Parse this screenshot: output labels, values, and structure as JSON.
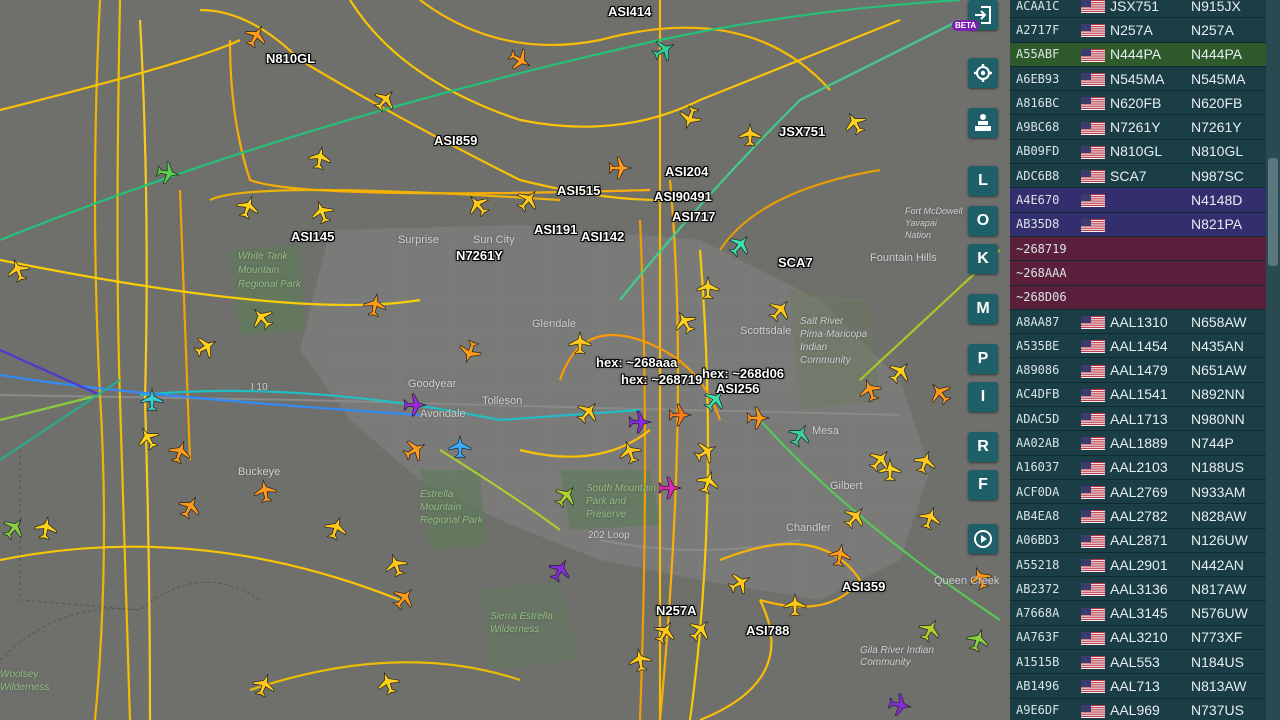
{
  "map": {
    "place_labels": [
      {
        "text": "Surprise"
      },
      {
        "text": "Sun City"
      },
      {
        "text": "Goodyear"
      },
      {
        "text": "Buckeye"
      },
      {
        "text": "Chandler"
      },
      {
        "text": "Gilbert"
      },
      {
        "text": "Fountain Hills"
      },
      {
        "text": "Queen Creek"
      },
      {
        "text": "Glendale"
      },
      {
        "text": "Scottsdale"
      },
      {
        "text": "Mesa"
      },
      {
        "text": "Tolleson"
      },
      {
        "text": "Avondale"
      }
    ],
    "park_labels": [
      {
        "text": "White Tank Mountain Regional Park"
      },
      {
        "text": "Estrella Mountain Regional Park"
      },
      {
        "text": "South Mountain Park and Preserve"
      },
      {
        "text": "Sierra Estrella Wilderness"
      },
      {
        "text": "Woolsey Wilderness"
      },
      {
        "text": "Salt River Pima-Maricopa Indian Community"
      },
      {
        "text": "Fort McDowell Yavapai Nation"
      },
      {
        "text": "Gila River Indian Community"
      }
    ],
    "road_labels": [
      {
        "text": "I 10"
      },
      {
        "text": "202 Loop"
      }
    ],
    "flight_labels": [
      {
        "text": "ASI414"
      },
      {
        "text": "N810GL"
      },
      {
        "text": "ASI859"
      },
      {
        "text": "JSX751"
      },
      {
        "text": "ASI204"
      },
      {
        "text": "ASI515"
      },
      {
        "text": "ASI90491"
      },
      {
        "text": "ASI717"
      },
      {
        "text": "ASI145"
      },
      {
        "text": "ASI191"
      },
      {
        "text": "ASI142"
      },
      {
        "text": "N7261Y"
      },
      {
        "text": "SCA7"
      },
      {
        "text": "hex: ~268aaa"
      },
      {
        "text": "hex: ~268719"
      },
      {
        "text": "hex: ~268d06"
      },
      {
        "text": "ASI256"
      },
      {
        "text": "N257A"
      },
      {
        "text": "ASI788"
      },
      {
        "text": "ASI359"
      }
    ]
  },
  "controls": {
    "beta": "BETA",
    "letters": [
      "L",
      "O",
      "K",
      "M",
      "P",
      "I",
      "R",
      "F"
    ]
  },
  "icons": [
    "login-icon",
    "settings-gear-icon",
    "layers-icon",
    "replay-icon",
    "us-flag-icon"
  ],
  "colors": {
    "table_bg": "#1b3d45",
    "row_highlight": "#2e5a2c",
    "row_selected": "#332e6e",
    "row_no_position": "#5a1f3a",
    "control_bg": "#1f5f68"
  },
  "aircraft_table": {
    "rows": [
      {
        "hex": "ACAA1C",
        "flag": true,
        "callsign": "JSX751",
        "reg": "N915JX",
        "style": "normal"
      },
      {
        "hex": "A2717F",
        "flag": true,
        "callsign": "N257A",
        "reg": "N257A",
        "style": "normal"
      },
      {
        "hex": "A55ABF",
        "flag": true,
        "callsign": "N444PA",
        "reg": "N444PA",
        "style": "highlight"
      },
      {
        "hex": "A6EB93",
        "flag": true,
        "callsign": "N545MA",
        "reg": "N545MA",
        "style": "normal"
      },
      {
        "hex": "A816BC",
        "flag": true,
        "callsign": "N620FB",
        "reg": "N620FB",
        "style": "normal"
      },
      {
        "hex": "A9BC68",
        "flag": true,
        "callsign": "N7261Y",
        "reg": "N7261Y",
        "style": "normal"
      },
      {
        "hex": "AB09FD",
        "flag": true,
        "callsign": "N810GL",
        "reg": "N810GL",
        "style": "normal"
      },
      {
        "hex": "ADC6B8",
        "flag": true,
        "callsign": "SCA7",
        "reg": "N987SC",
        "style": "normal"
      },
      {
        "hex": "A4E670",
        "flag": true,
        "callsign": "",
        "reg": "N4148D",
        "style": "selected"
      },
      {
        "hex": "AB35D8",
        "flag": true,
        "callsign": "",
        "reg": "N821PA",
        "style": "selected"
      },
      {
        "hex": "~268719",
        "flag": false,
        "callsign": "",
        "reg": "",
        "style": "noposition"
      },
      {
        "hex": "~268AAA",
        "flag": false,
        "callsign": "",
        "reg": "",
        "style": "noposition"
      },
      {
        "hex": "~268D06",
        "flag": false,
        "callsign": "",
        "reg": "",
        "style": "noposition"
      },
      {
        "hex": "A8AA87",
        "flag": true,
        "callsign": "AAL1310",
        "reg": "N658AW",
        "style": "normal"
      },
      {
        "hex": "A535BE",
        "flag": true,
        "callsign": "AAL1454",
        "reg": "N435AN",
        "style": "normal"
      },
      {
        "hex": "A89086",
        "flag": true,
        "callsign": "AAL1479",
        "reg": "N651AW",
        "style": "normal"
      },
      {
        "hex": "AC4DFB",
        "flag": true,
        "callsign": "AAL1541",
        "reg": "N892NN",
        "style": "normal"
      },
      {
        "hex": "ADAC5D",
        "flag": true,
        "callsign": "AAL1713",
        "reg": "N980NN",
        "style": "normal"
      },
      {
        "hex": "AA02AB",
        "flag": true,
        "callsign": "AAL1889",
        "reg": "N744P",
        "style": "normal"
      },
      {
        "hex": "A16037",
        "flag": true,
        "callsign": "AAL2103",
        "reg": "N188US",
        "style": "normal"
      },
      {
        "hex": "ACF0DA",
        "flag": true,
        "callsign": "AAL2769",
        "reg": "N933AM",
        "style": "normal"
      },
      {
        "hex": "AB4EA8",
        "flag": true,
        "callsign": "AAL2782",
        "reg": "N828AW",
        "style": "normal"
      },
      {
        "hex": "A06BD3",
        "flag": true,
        "callsign": "AAL2871",
        "reg": "N126UW",
        "style": "normal"
      },
      {
        "hex": "A55218",
        "flag": true,
        "callsign": "AAL2901",
        "reg": "N442AN",
        "style": "normal"
      },
      {
        "hex": "AB2372",
        "flag": true,
        "callsign": "AAL3136",
        "reg": "N817AW",
        "style": "normal"
      },
      {
        "hex": "A7668A",
        "flag": true,
        "callsign": "AAL3145",
        "reg": "N576UW",
        "style": "normal"
      },
      {
        "hex": "AA763F",
        "flag": true,
        "callsign": "AAL3210",
        "reg": "N773XF",
        "style": "normal"
      },
      {
        "hex": "A1515B",
        "flag": true,
        "callsign": "AAL553",
        "reg": "N184US",
        "style": "normal"
      },
      {
        "hex": "AB1496",
        "flag": true,
        "callsign": "AAL713",
        "reg": "N813AW",
        "style": "normal"
      },
      {
        "hex": "A9E6DF",
        "flag": true,
        "callsign": "AAL969",
        "reg": "N737US",
        "style": "normal"
      }
    ]
  }
}
